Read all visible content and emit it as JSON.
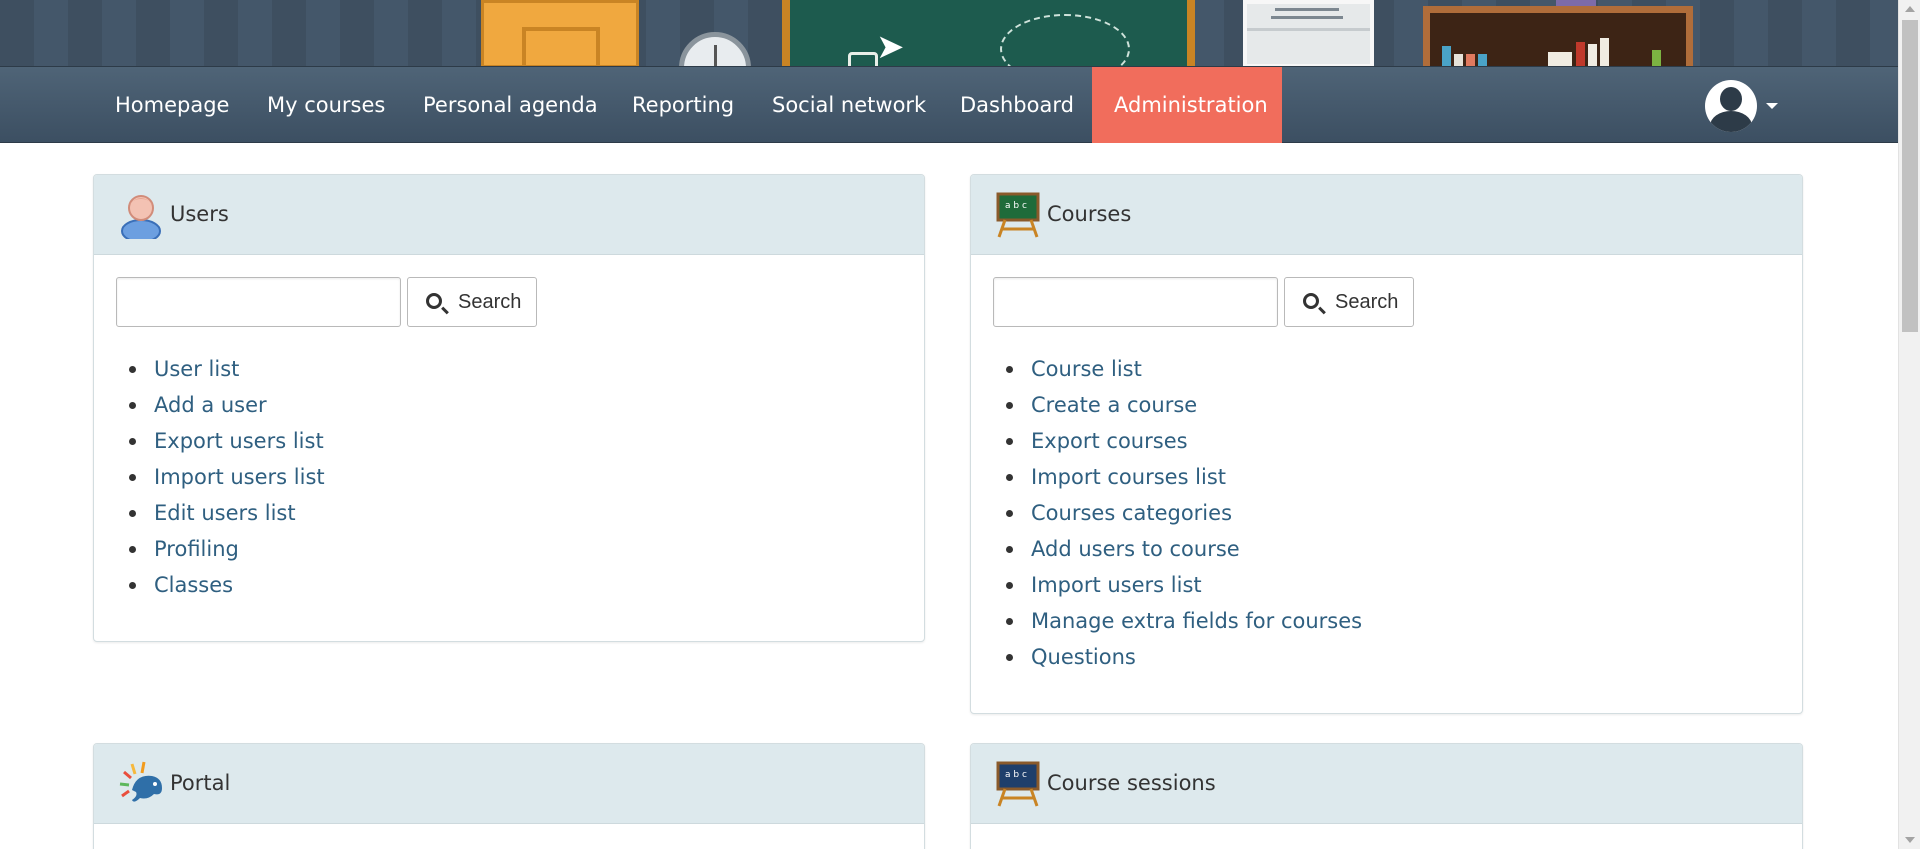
{
  "navbar": {
    "items": [
      {
        "label": "Homepage"
      },
      {
        "label": "My courses"
      },
      {
        "label": "Personal agenda"
      },
      {
        "label": "Reporting"
      },
      {
        "label": "Social network"
      },
      {
        "label": "Dashboard"
      },
      {
        "label": "Administration",
        "active": true
      }
    ],
    "active_color": "#f16d5c",
    "bar_color": "#435669"
  },
  "panels": {
    "users": {
      "title": "Users",
      "icon": "user-icon",
      "search_label": "Search",
      "links": [
        "User list",
        "Add a user",
        "Export users list",
        "Import users list",
        "Edit users list",
        "Profiling",
        "Classes"
      ]
    },
    "courses": {
      "title": "Courses",
      "icon": "chalkboard-icon",
      "search_label": "Search",
      "links": [
        "Course list",
        "Create a course",
        "Export courses",
        "Import courses list",
        "Courses categories",
        "Add users to course",
        "Import users list",
        "Manage extra fields for courses",
        "Questions"
      ]
    },
    "portal": {
      "title": "Portal",
      "icon": "chamilo-logo-icon"
    },
    "course_sessions": {
      "title": "Course sessions",
      "icon": "chalkboard-icon"
    }
  },
  "colors": {
    "link": "#2f5f80",
    "panel_heading": "#dde9ed"
  }
}
